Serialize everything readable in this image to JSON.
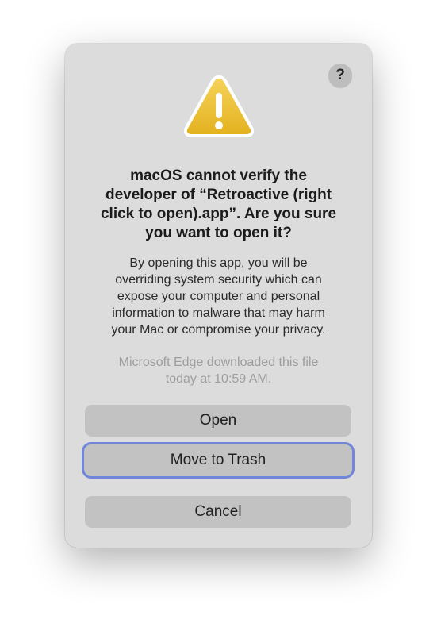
{
  "dialog": {
    "help_icon": "question-mark-icon",
    "warning_icon": "warning-triangle-icon",
    "help_label": "?",
    "title_lines": [
      "macOS cannot verify the",
      "developer of “Retroactive (right",
      "click to open).app”. Are you sure",
      "you want to open it?"
    ],
    "body_lines": [
      "By opening this app, you will be",
      "overriding system security which can",
      "expose your computer and personal",
      "information to malware that may harm",
      "your Mac or compromise your privacy."
    ],
    "meta_lines": [
      "Microsoft Edge downloaded this file",
      "today at 10:59 AM."
    ],
    "buttons": {
      "open": "Open",
      "move_to_trash": "Move to Trash",
      "cancel": "Cancel"
    },
    "colors": {
      "dialog_bg": "#dcdcdc",
      "button_bg": "#c2c2c2",
      "focus_ring": "#6f86da",
      "warning_yellow": "#f2c230"
    }
  }
}
